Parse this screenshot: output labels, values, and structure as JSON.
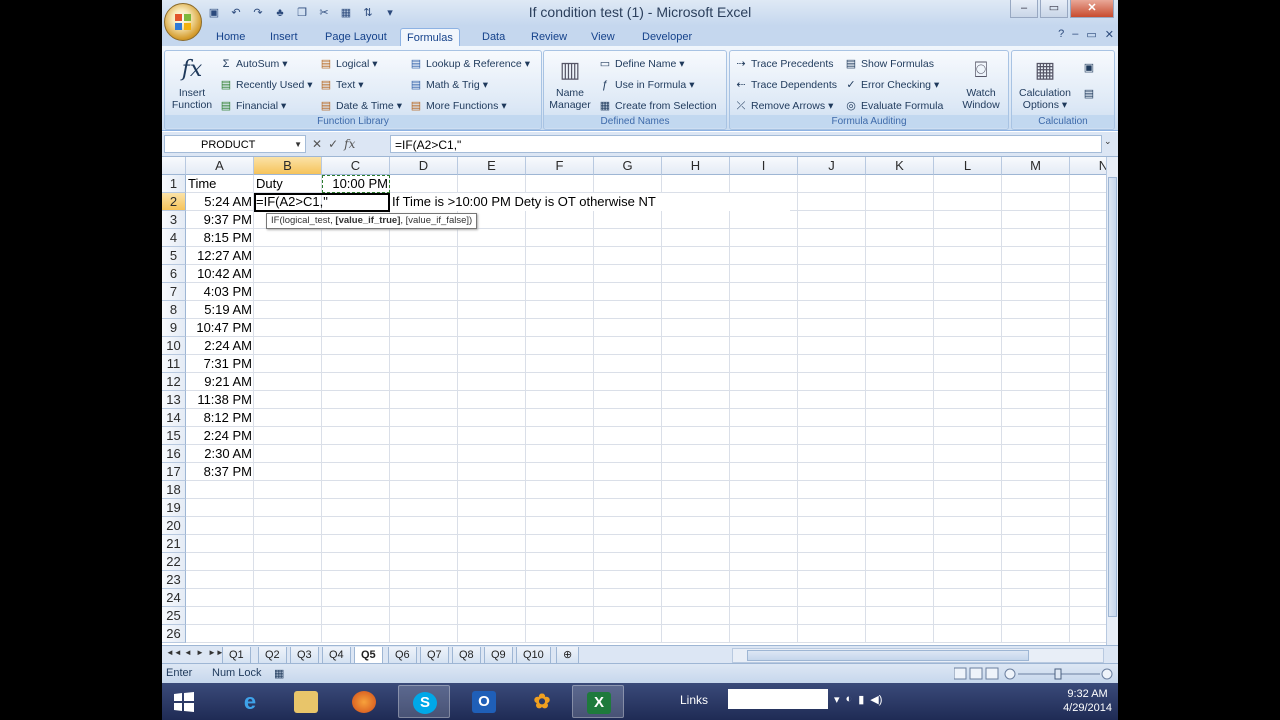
{
  "window": {
    "title": "If condition test (1) - Microsoft Excel",
    "controls": {
      "minimize": "–",
      "restore": "▭",
      "close": "✕"
    }
  },
  "ribbon_tabs": [
    {
      "label": "Home"
    },
    {
      "label": "Insert"
    },
    {
      "label": "Page Layout"
    },
    {
      "label": "Formulas",
      "active": true
    },
    {
      "label": "Data"
    },
    {
      "label": "Review"
    },
    {
      "label": "View"
    },
    {
      "label": "Developer"
    }
  ],
  "ribbon": {
    "insert_function": "Insert Function",
    "function_library": {
      "label": "Function Library",
      "autosum": "AutoSum",
      "recently_used": "Recently Used",
      "financial": "Financial",
      "logical": "Logical",
      "text": "Text",
      "date_time": "Date & Time",
      "lookup_reference": "Lookup & Reference",
      "math_trig": "Math & Trig",
      "more_functions": "More Functions"
    },
    "defined_names": {
      "label": "Defined Names",
      "name_manager": "Name Manager",
      "define_name": "Define Name",
      "use_in_formula": "Use in Formula",
      "create_from_selection": "Create from Selection"
    },
    "formula_auditing": {
      "label": "Formula Auditing",
      "trace_precedents": "Trace Precedents",
      "trace_dependents": "Trace Dependents",
      "remove_arrows": "Remove Arrows",
      "show_formulas": "Show Formulas",
      "error_checking": "Error Checking",
      "evaluate_formula": "Evaluate Formula",
      "watch_window": "Watch Window"
    },
    "calculation": {
      "label": "Calculation",
      "calculation_options": "Calculation Options"
    }
  },
  "formula_bar": {
    "name_box": "PRODUCT",
    "formula": "=IF(A2>C1,\""
  },
  "grid": {
    "columns": [
      "A",
      "B",
      "C",
      "D",
      "E",
      "F",
      "G",
      "H",
      "I",
      "J",
      "K",
      "L",
      "M",
      "N"
    ],
    "rows": [
      "1",
      "2",
      "3",
      "4",
      "5",
      "6",
      "7",
      "8",
      "9",
      "10",
      "11",
      "12",
      "13",
      "14",
      "15",
      "16",
      "17",
      "18",
      "19",
      "20",
      "21",
      "22",
      "23",
      "24",
      "25",
      "26"
    ],
    "cells": {
      "A1": "Time",
      "B1": "Duty",
      "C1": "10:00 PM",
      "A2": "5:24 AM",
      "B2": "=IF(A2>C1,\"",
      "D2": "If Time is >10:00 PM Dety is OT otherwise NT",
      "A3": "9:37 PM",
      "A4": "8:15 PM",
      "A5": "12:27 AM",
      "A6": "10:42 AM",
      "A7": "4:03 PM",
      "A8": "5:19 AM",
      "A9": "10:47 PM",
      "A10": "2:24 AM",
      "A11": "7:31 PM",
      "A12": "9:21 AM",
      "A13": "11:38 PM",
      "A14": "8:12 PM",
      "A15": "2:24 PM",
      "A16": "2:30 AM",
      "A17": "8:37 PM"
    },
    "tooltip": {
      "prefix": "IF(logical_test, ",
      "bold": "[value_if_true]",
      "suffix": ", [value_if_false])"
    }
  },
  "sheets": [
    "Q1",
    "Q2",
    "Q3",
    "Q4",
    "Q5",
    "Q6",
    "Q7",
    "Q8",
    "Q9",
    "Q10"
  ],
  "active_sheet": "Q5",
  "status": {
    "mode": "Enter",
    "numlock": "Num Lock"
  },
  "taskbar": {
    "links": "Links",
    "time": "9:32 AM",
    "date": "4/29/2014"
  }
}
